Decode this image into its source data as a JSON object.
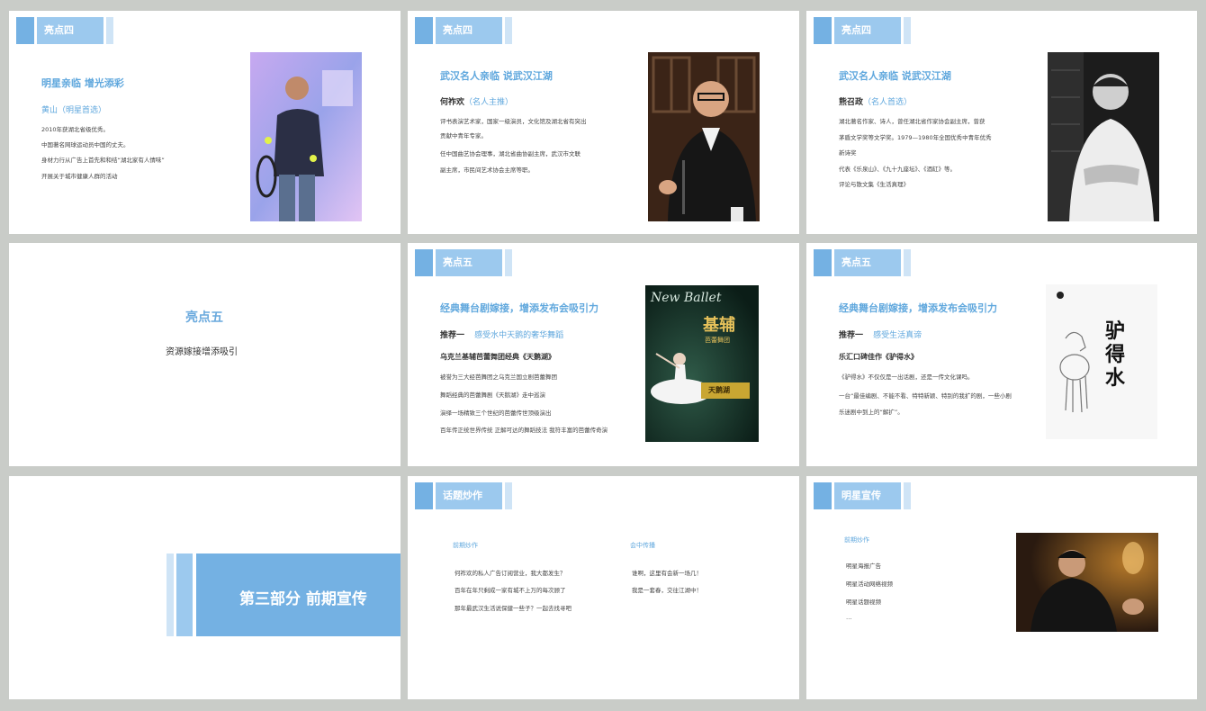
{
  "slides": {
    "s1": {
      "header": "亮点四",
      "title": "明星亲临  增光添彩",
      "subtitle": "黄山（明星首选）",
      "lines": [
        "2010年获湖北省级优秀。",
        "中国著名网球运动员中国的丈夫。",
        "身材力行从广告上首先和和结“湖北家有人情味”",
        "开展关于城市健康人群的活动"
      ]
    },
    "s2": {
      "header": "亮点四",
      "title": "武汉名人亲临  说武汉江湖",
      "subtitle_name": "何祚欢",
      "subtitle_role": "（名人主推）",
      "lines": [
        "评书表演艺术家，国家一级演员，文化馆及湖北省有突出",
        "贡献中青年专家。",
        "任中国曲艺协会理事，湖北省曲协副主席，武汉市文联",
        "副主席，市民间艺术协会主席等职。"
      ]
    },
    "s3": {
      "header": "亮点四",
      "title": "武汉名人亲临  说武汉江湖",
      "subtitle_name": "熊召政",
      "subtitle_role": "（名人首选）",
      "lines": [
        "湖北著名作家、诗人，曾任湖北省作家协会副主席，曾获",
        "茅盾文学奖等文学奖。1979—1980年全国优秀中青年优秀",
        "新诗奖",
        "代表《乐泉山》、《九十九座坛》、《酒缸》等。",
        "评论与散文集《生活真理》"
      ]
    },
    "s4": {
      "title": "亮点五",
      "subtitle": "资源嫁接增添吸引"
    },
    "s5": {
      "header": "亮点五",
      "title": "经典舞台剧嫁接，增添发布会吸引力",
      "rec_label": "推荐一",
      "rec_value": "感受水中天鹅的奢华舞蹈",
      "bold_line": "乌克兰基辅芭蕾舞团经典《天鹅湖》",
      "lines": [
        "被誉为三大经芭舞团之乌克兰国立剧芭蕾舞团",
        "舞蹈经典的芭蕾舞剧《天鹅湖》走中巡演",
        "演绎一场精致三个世纪的芭蕾传世顶级演出",
        "百年传正统世界传统  正解可达的舞蹈技法  我符丰富的芭蕾传奇演"
      ],
      "poster": {
        "script": "New Ballet",
        "title": "基辅",
        "sub": "芭蕾舞团",
        "name": "天鹅湖"
      }
    },
    "s6": {
      "header": "亮点五",
      "title": "经典舞台剧嫁接，增添发布会吸引力",
      "rec_label": "推荐一",
      "rec_value": "感受生活真谛",
      "bold_line": "乐汇口碑佳作《驴得水》",
      "lines": [
        "《驴得水》不仅仅是一出话剧，还是一传文化课吗。",
        "一台“最佳编剧、不能不看、特特新颖、特别的我扩的剧，一些小剧",
        "乐迷剧中到上的“解扩”。"
      ],
      "poster": {
        "title": "驴得水"
      }
    },
    "s7": {
      "part": "第三部分    前期宣传"
    },
    "s8": {
      "header": "话题炒作",
      "col1_title": "前期炒作",
      "col1_lines": [
        "何祚欢的私人广告订阅营业，我大都发生？",
        "百年在年只剩成一家有城不上万的每次顾了",
        "那年最武汉生活说保健一些子？一起去找寻吧"
      ],
      "col2_title": "会中传播",
      "col2_lines": [
        "谁啊，这里有会新一场几！",
        "我是一套春，交往江湖中！"
      ]
    },
    "s9": {
      "header": "明星宣传",
      "col_title": "前期炒作",
      "lines": [
        "明星海报广告",
        "明星活动网络视频",
        "明星话题视频",
        "…"
      ]
    }
  }
}
